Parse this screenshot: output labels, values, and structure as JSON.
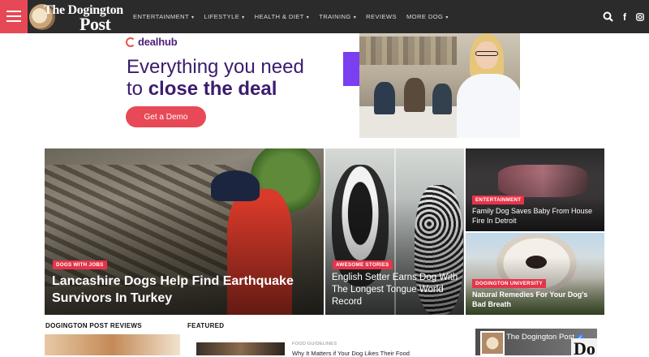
{
  "nav": {
    "logo_line1": "The Dogington",
    "logo_line2": "Post",
    "items": [
      {
        "label": "ENTERTAINMENT",
        "dropdown": "▾"
      },
      {
        "label": "LIFESTYLE",
        "dropdown": "▾"
      },
      {
        "label": "HEALTH & DIET",
        "dropdown": "▾"
      },
      {
        "label": "TRAINING",
        "dropdown": "▾"
      },
      {
        "label": "REVIEWS",
        "dropdown": ""
      },
      {
        "label": "MORE DOG",
        "dropdown": "▾"
      }
    ],
    "icons": [
      "search-icon",
      "facebook-icon",
      "instagram-icon"
    ],
    "accent_color": "#e74856",
    "bar_color": "#2b2b2b"
  },
  "ad": {
    "brand": "dealhub",
    "line1": "Everything you need",
    "line2_prefix": "to ",
    "line2_bold": "close the deal",
    "cta": "Get a Demo",
    "brand_color": "#3a1c6e",
    "cta_color": "#e84956"
  },
  "grid": {
    "main": {
      "tag": "DOGS WITH JOBS",
      "title": "Lancashire Dogs Help Find Earthquake Survivors In Turkey"
    },
    "middle": {
      "tag": "AWESOME STORIES",
      "title": "English Setter Earns Dog With The Longest Tongue World Record"
    },
    "top_right": {
      "tag": "ENTERTAINMENT",
      "title": "Family Dog Saves Baby From House Fire In Detroit"
    },
    "bottom_right": {
      "tag": "DOGINGTON UNIVERSITY",
      "title": "Natural Remedies For Your Dog's Bad Breath"
    },
    "tag_color": "#e5344a"
  },
  "sections": {
    "reviews_heading": "DOGINGTON POST REVIEWS",
    "featured_heading": "FEATURED",
    "featured_item": {
      "category": "FOOD GUIDELINES",
      "title": "Why It Matters if Your Dog Likes Their Food"
    },
    "fb_widget": {
      "name": "The Dogington Post",
      "verified": "✓",
      "overlay_text": "Do"
    }
  }
}
